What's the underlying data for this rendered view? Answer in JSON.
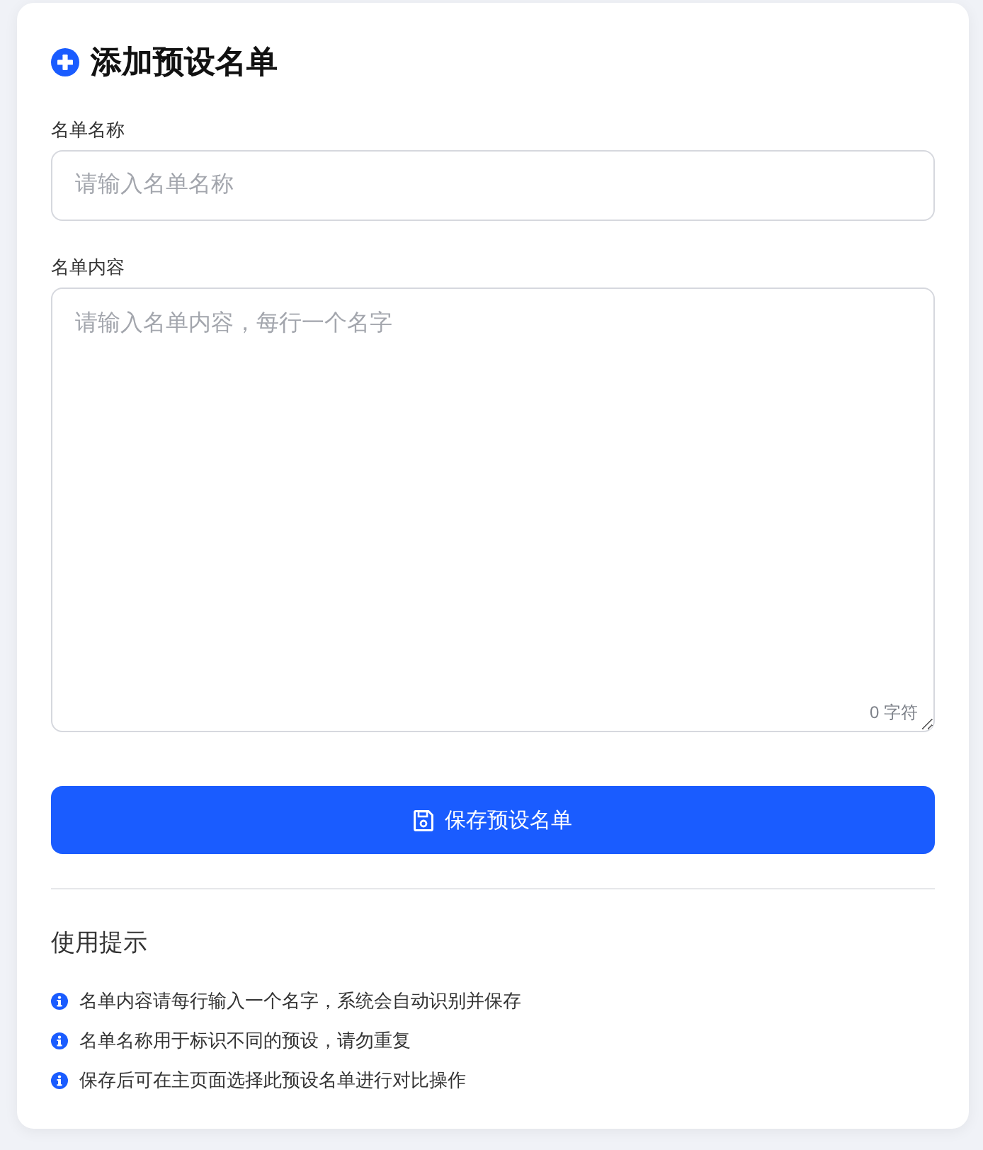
{
  "form": {
    "title": "添加预设名单",
    "fields": [
      {
        "kind": "input",
        "label": "名单名称",
        "placeholder": "请输入名单名称"
      },
      {
        "kind": "textarea",
        "label": "名单内容",
        "placeholder": "请输入名单内容，每行一个名字",
        "counter": "0 字符"
      }
    ],
    "save_button": {
      "label": "保存预设名单"
    }
  },
  "tips": {
    "title": "使用提示",
    "items": [
      "名单内容请每行输入一个名字，系统会自动识别并保存",
      "名单名称用于标识不同的预设，请勿重复",
      "保存后可在主页面选择此预设名单进行对比操作"
    ]
  }
}
